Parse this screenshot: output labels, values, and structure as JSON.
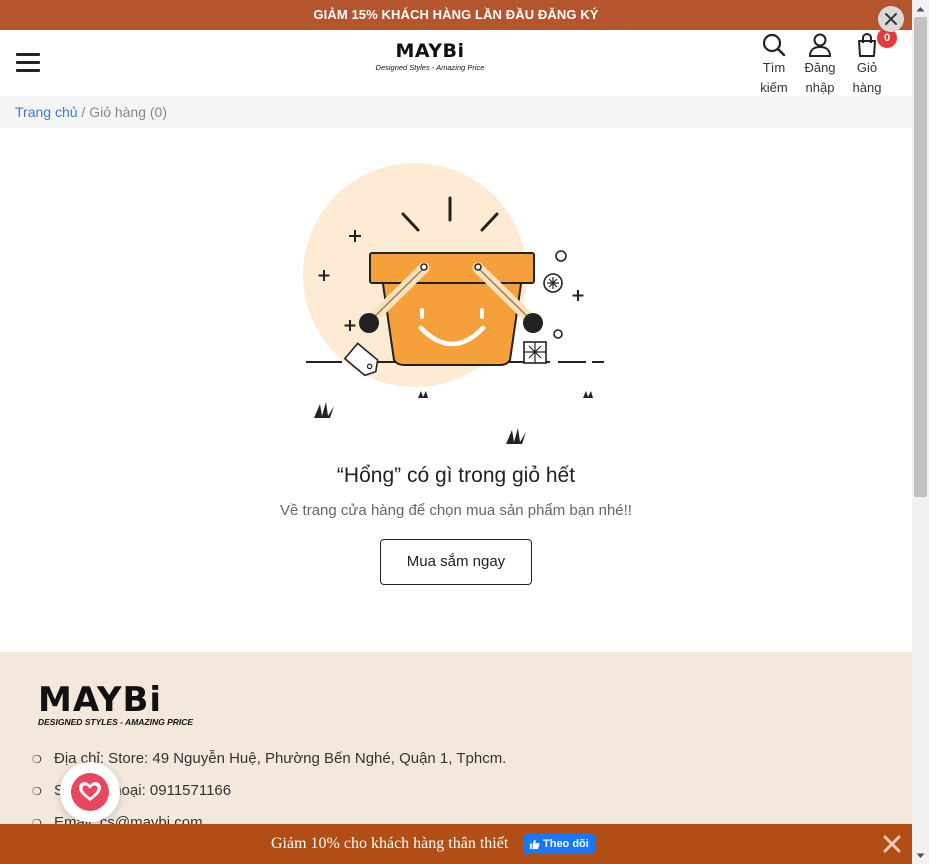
{
  "promo_bar": {
    "text": "GIẢM 15% KHÁCH HÀNG LẦN ĐẦU ĐĂNG KÝ"
  },
  "header": {
    "logo_brand": "MAYBi",
    "logo_tagline": "Designed Styles - Amazing Price",
    "search_label_1": "Tìm",
    "search_label_2": "kiếm",
    "login_label_1": "Đăng",
    "login_label_2": "nhập",
    "cart_label_1": "Giỏ",
    "cart_label_2": "hàng",
    "cart_count": "0"
  },
  "breadcrumb": {
    "home": "Trang chủ",
    "separator": "/",
    "current": "Giỏ hàng (0)"
  },
  "empty_cart": {
    "title": "“Hổng” có gì trong giỏ hết",
    "subtitle": "Về trang cửa hàng để chọn mua sản phẩm bạn nhé!!",
    "button": "Mua sắm ngay"
  },
  "footer": {
    "logo_brand": "MAYBi",
    "logo_tagline": "DESIGNED STYLES - AMAZING PRICE",
    "address": "Địa chỉ: Store: 49 Nguyễn Huệ, Phường Bến Nghé, Quận 1, Tphcm.",
    "phone": "Số điện thoại: 0911571166",
    "email": "Email: cs@maybi.com"
  },
  "bottom_bar": {
    "text": "Giảm 10% cho khách hàng thân thiết",
    "follow_label": "Theo dõi"
  },
  "colors": {
    "promo": "#b4552f",
    "bottom_bar": "#b04e16",
    "footer_bg": "#f4e8dc",
    "accent_link": "#3a7bd5",
    "badge": "#e23b3b",
    "basket": "#f5a03a"
  }
}
